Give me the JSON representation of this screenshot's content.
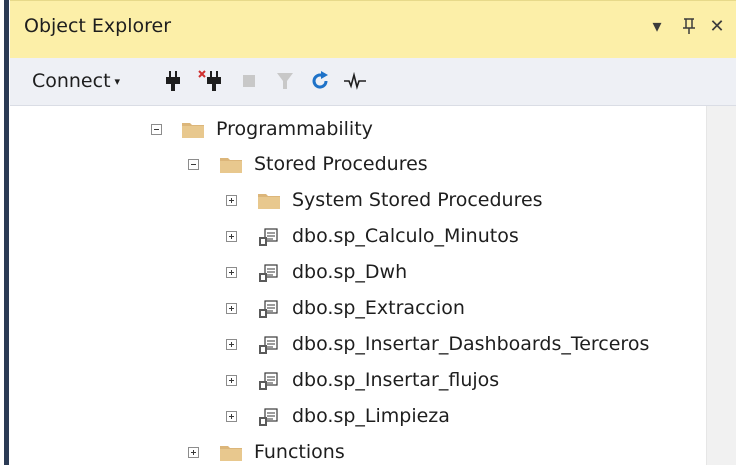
{
  "panel": {
    "title": "Object Explorer",
    "title_buttons": [
      "▾",
      "⊥",
      "✕"
    ]
  },
  "toolbar": {
    "connect_label": "Connect",
    "connect_caret": "▾",
    "icons": [
      "connect-plug-icon",
      "disconnect-plug-icon",
      "stop-icon",
      "filter-icon",
      "refresh-icon",
      "activity-monitor-icon"
    ]
  },
  "tree": {
    "nodes": [
      {
        "label": "Programmability",
        "type": "folder",
        "state": "expanded",
        "depth": 0
      },
      {
        "label": "Stored Procedures",
        "type": "folder",
        "state": "expanded",
        "depth": 1
      },
      {
        "label": "System Stored Procedures",
        "type": "folder",
        "state": "collapsed",
        "depth": 2
      },
      {
        "label": "dbo.sp_Calculo_Minutos",
        "type": "procedure",
        "state": "collapsed",
        "depth": 2
      },
      {
        "label": "dbo.sp_Dwh",
        "type": "procedure",
        "state": "collapsed",
        "depth": 2
      },
      {
        "label": "dbo.sp_Extraccion",
        "type": "procedure",
        "state": "collapsed",
        "depth": 2
      },
      {
        "label": "dbo.sp_Insertar_Dashboards_Terceros",
        "type": "procedure",
        "state": "collapsed",
        "depth": 2
      },
      {
        "label": "dbo.sp_Insertar_flujos",
        "type": "procedure",
        "state": "collapsed",
        "depth": 2
      },
      {
        "label": "dbo.sp_Limpieza",
        "type": "procedure",
        "state": "collapsed",
        "depth": 2
      },
      {
        "label": "Functions",
        "type": "folder",
        "state": "collapsed",
        "depth": 1
      }
    ]
  },
  "colors": {
    "title_bar": "#fcefa8",
    "toolbar": "#eef0f5",
    "folder": "#dcb67a",
    "refresh": "#1e72c8"
  }
}
